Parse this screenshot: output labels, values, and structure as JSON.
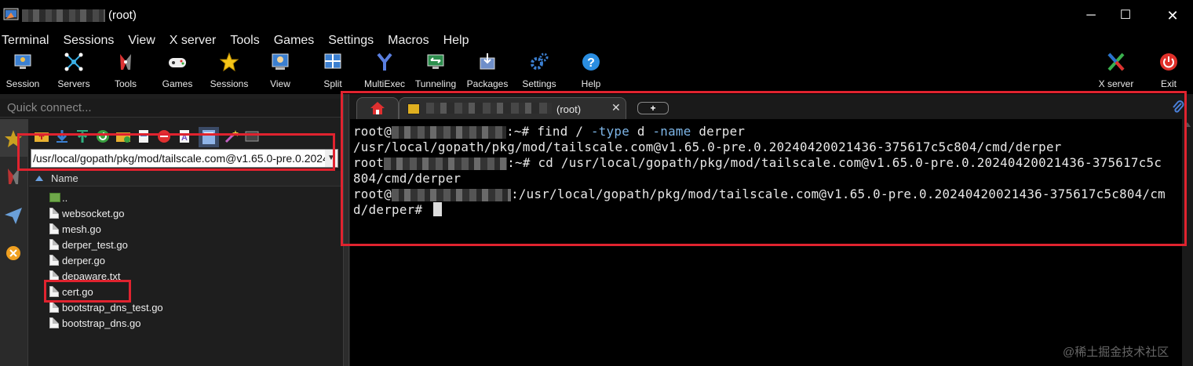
{
  "window": {
    "title": "(root)",
    "minimize": "─",
    "maximize": "☐",
    "close": "✕"
  },
  "menu": [
    "Terminal",
    "Sessions",
    "View",
    "X server",
    "Tools",
    "Games",
    "Settings",
    "Macros",
    "Help"
  ],
  "toolbar": {
    "items": [
      {
        "label": "Session",
        "icon": "session-icon"
      },
      {
        "label": "Servers",
        "icon": "servers-icon"
      },
      {
        "label": "Tools",
        "icon": "tools-icon"
      },
      {
        "label": "Games",
        "icon": "games-icon"
      },
      {
        "label": "Sessions",
        "icon": "star-icon"
      },
      {
        "label": "View",
        "icon": "view-icon"
      },
      {
        "label": "Split",
        "icon": "split-icon"
      },
      {
        "label": "MultiExec",
        "icon": "multiexec-icon"
      },
      {
        "label": "Tunneling",
        "icon": "tunneling-icon"
      },
      {
        "label": "Packages",
        "icon": "packages-icon"
      },
      {
        "label": "Settings",
        "icon": "settings-icon"
      },
      {
        "label": "Help",
        "icon": "help-icon"
      }
    ],
    "xserver": "X server",
    "exit": "Exit"
  },
  "quick_connect": {
    "placeholder": "Quick connect..."
  },
  "file_browser": {
    "path": "/usr/local/gopath/pkg/mod/tailscale.com@v1.65.0-pre.0.20240420021436-375617c5c804/cmd/derper",
    "column_name": "Name",
    "files": [
      "..",
      "websocket.go",
      "mesh.go",
      "derper_test.go",
      "derper.go",
      "depaware.txt",
      "cert.go",
      "bootstrap_dns_test.go",
      "bootstrap_dns.go"
    ]
  },
  "tabs": {
    "session_label": "(root)",
    "close": "✕",
    "new": "+"
  },
  "terminal": {
    "line1_prompt": "root@",
    "line1_sep": ":~# ",
    "line1_cmd": "find / ",
    "line1_opt1": "-type",
    "line1_mid": " d ",
    "line1_opt2": "-name",
    "line1_arg": " derper",
    "line2": "/usr/local/gopath/pkg/mod/tailscale.com@v1.65.0-pre.0.20240420021436-375617c5c804/cmd/derper",
    "line3_prompt": "root",
    "line3_rest": ":~# cd /usr/local/gopath/pkg/mod/tailscale.com@v1.65.0-pre.0.20240420021436-375617c5c",
    "line4": "804/cmd/derper",
    "line5_prompt": "root@",
    "line5_rest": ":/usr/local/gopath/pkg/mod/tailscale.com@v1.65.0-pre.0.20240420021436-375617c5c804/cm",
    "line6": "d/derper# "
  },
  "watermark": "@稀土掘金技术社区",
  "colors": {
    "highlight": "#e0232f",
    "keyword": "#7eb6e8",
    "background": "#000000"
  }
}
